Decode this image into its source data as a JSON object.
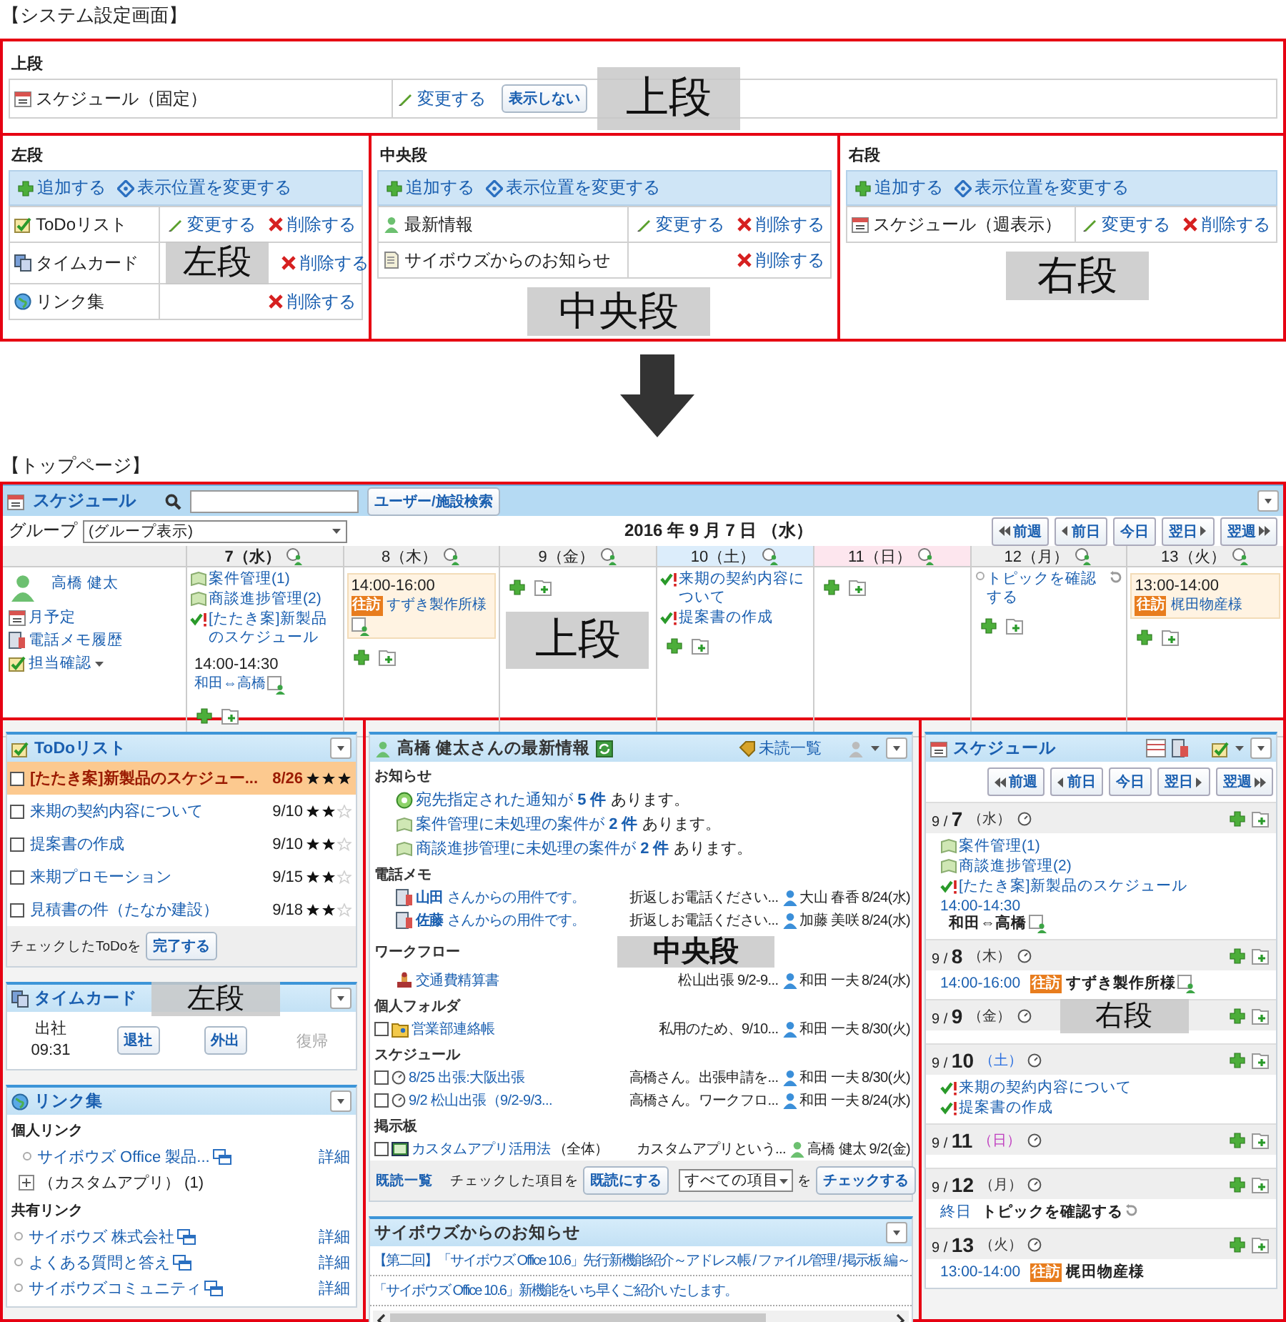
{
  "settings": {
    "title": "【システム設定画面】",
    "upper": {
      "label": "上段",
      "overlay": "上段",
      "rows": [
        {
          "name": "スケジュール（固定）",
          "change": "変更する",
          "hide": "表示しない"
        }
      ]
    },
    "columns": [
      {
        "label": "左段",
        "overlay": "左段",
        "add": "追加する",
        "move": "表示位置を変更する",
        "rows": [
          {
            "name": "ToDoリスト",
            "change": "変更する",
            "delete": "削除する"
          },
          {
            "name": "タイムカード",
            "delete": "削除する"
          },
          {
            "name": "リンク集",
            "delete": "削除する"
          }
        ]
      },
      {
        "label": "中央段",
        "overlay": "中央段",
        "add": "追加する",
        "move": "表示位置を変更する",
        "rows": [
          {
            "name": "最新情報",
            "change": "変更する",
            "delete": "削除する"
          },
          {
            "name": "サイボウズからのお知らせ",
            "delete": "削除する"
          }
        ]
      },
      {
        "label": "右段",
        "overlay": "右段",
        "add": "追加する",
        "move": "表示位置を変更する",
        "rows": [
          {
            "name": "スケジュール（週表示）",
            "change": "変更する",
            "delete": "削除する"
          }
        ]
      }
    ]
  },
  "toppage": {
    "title": "【トップページ】",
    "schedule": {
      "overlay": "上段",
      "title": "スケジュール",
      "search_button": "ユーザー/施設検索",
      "group_label": "グループ",
      "group_value": "(グループ表示)",
      "date": "2016 年 9 月 7 日 （水）",
      "nav": [
        {
          "kind": "prev-week",
          "label": "前週"
        },
        {
          "kind": "prev-day",
          "label": "前日"
        },
        {
          "kind": "today",
          "label": "今日"
        },
        {
          "kind": "next-day",
          "label": "翌日"
        },
        {
          "kind": "next-week",
          "label": "翌週"
        }
      ],
      "user": {
        "name": "高橋 健太",
        "links": [
          "月予定",
          "電話メモ履歴",
          "担当確認"
        ]
      },
      "days": [
        {
          "label": "7（水）",
          "kind": "weekday",
          "today": true,
          "entries": [
            {
              "kind": "app",
              "text": "案件管理(1)"
            },
            {
              "kind": "app",
              "text": "商談進捗管理(2)"
            },
            {
              "kind": "todo",
              "text": "[たたき案]新製品のスケジュール"
            },
            {
              "kind": "event",
              "time": "14:00-14:30",
              "title": "和田⇔高橋",
              "facility": true,
              "highlight": false
            }
          ]
        },
        {
          "label": "8（木）",
          "kind": "weekday",
          "today": false,
          "entries": [
            {
              "kind": "event",
              "time": "14:00-16:00",
              "tag": "往訪",
              "title": "すずき製作所様",
              "facility": true,
              "highlight": true
            }
          ]
        },
        {
          "label": "9（金）",
          "kind": "weekday",
          "today": false
        },
        {
          "label": "10（土）",
          "kind": "saturday",
          "today": false,
          "entries": [
            {
              "kind": "todo",
              "text": "来期の契約内容について"
            },
            {
              "kind": "todo",
              "text": "提案書の作成"
            }
          ]
        },
        {
          "label": "11（日）",
          "kind": "sunday",
          "today": false
        },
        {
          "label": "12（月）",
          "kind": "weekday",
          "today": false,
          "entries": [
            {
              "kind": "allday",
              "title": "トピックを確認する"
            }
          ]
        },
        {
          "label": "13（火）",
          "kind": "weekday",
          "today": false,
          "entries": [
            {
              "kind": "event",
              "time": "13:00-14:00",
              "tag": "往訪",
              "title": "梶田物産様",
              "facility": false,
              "highlight": true
            }
          ]
        }
      ]
    },
    "left": {
      "overlay": "左段",
      "todo": {
        "title": "ToDoリスト",
        "items": [
          {
            "title": "[たたき案]新製品のスケジュー...",
            "date": "8/26",
            "stars": 3,
            "overdue": true,
            "checked": false
          },
          {
            "title": "来期の契約内容について",
            "date": "9/10",
            "stars": 2,
            "overdue": false,
            "checked": false
          },
          {
            "title": "提案書の作成",
            "date": "9/10",
            "stars": 2,
            "overdue": false,
            "checked": false
          },
          {
            "title": "来期プロモーション",
            "date": "9/15",
            "stars": 2,
            "overdue": false,
            "checked": false
          },
          {
            "title": "見積書の件（たなか建設）",
            "date": "9/18",
            "stars": 2,
            "overdue": false,
            "checked": false
          }
        ],
        "footer": "チェックしたToDoを",
        "button": "完了する"
      },
      "timecard": {
        "title": "タイムカード",
        "status": "出社",
        "time": "09:31",
        "buttons": [
          {
            "label": "退社",
            "disabled": false
          },
          {
            "label": "外出",
            "disabled": false
          },
          {
            "label": "復帰",
            "disabled": true
          }
        ]
      },
      "links": {
        "title": "リンク集",
        "groups": [
          {
            "heading": "個人リンク",
            "items": [
              {
                "kind": "link",
                "text": "サイボウズ Office 製品...",
                "detail": "詳細"
              },
              {
                "kind": "folder",
                "text": "（カスタムアプリ） (1)",
                "expanded": false
              }
            ]
          },
          {
            "heading": "共有リンク",
            "items": [
              {
                "kind": "link",
                "text": "サイボウズ 株式会社",
                "detail": "詳細"
              },
              {
                "kind": "link",
                "text": "よくある質問と答え",
                "detail": "詳細"
              },
              {
                "kind": "link",
                "text": "サイボウズコミュニティ",
                "detail": "詳細"
              }
            ]
          }
        ]
      }
    },
    "center": {
      "overlay": "中央段",
      "news": {
        "title": "高橋 健太さんの最新情報",
        "unread": "未読一覧",
        "sections": [
          {
            "heading": "お知らせ",
            "kind": "notice",
            "items": [
              {
                "kind": "notification",
                "text": "宛先指定された通知が",
                "count": "5 件",
                "rest": "あります。"
              },
              {
                "kind": "app",
                "text": "案件管理に未処理の案件が",
                "count": "2 件",
                "rest": "あります。"
              },
              {
                "kind": "app",
                "text": "商談進捗管理に未処理の案件が",
                "count": "2 件",
                "rest": "あります。"
              }
            ]
          },
          {
            "heading": "電話メモ",
            "kind": "memo",
            "items": [
              {
                "title": "**山田** さんからの用件です。",
                "preview": "折返しお電話ください...",
                "person": "大山 春香",
                "color": "#3b8fd9",
                "date": "8/24(水)"
              },
              {
                "title": "**佐藤** さんからの用件です。",
                "preview": "折返しお電話ください...",
                "person": "加藤 美咲",
                "color": "#3b8fd9",
                "date": "8/24(水)"
              }
            ]
          },
          {
            "heading": "ワークフロー",
            "kind": "workflow",
            "items": [
              {
                "title": "交通費精算書",
                "preview": "松山出張 9/2-9...",
                "person": "和田 一夫",
                "color": "#3b8fd9",
                "date": "8/24(水)"
              }
            ]
          },
          {
            "heading": "個人フォルダ",
            "kind": "folder",
            "items": [
              {
                "title": "営業部連絡帳",
                "preview": "私用のため、9/10...",
                "person": "和田 一夫",
                "color": "#3b8fd9",
                "date": "8/30(火)",
                "checked": false
              }
            ]
          },
          {
            "heading": "スケジュール",
            "kind": "schedule",
            "items": [
              {
                "title": "8/25 出張:大阪出張",
                "preview": "高橋さん。出張申請を...",
                "person": "和田 一夫",
                "color": "#3b8fd9",
                "date": "8/30(火)",
                "checked": false
              },
              {
                "title": "9/2 松山出張（9/2-9/3...",
                "preview": "高橋さん。ワークフロ...",
                "person": "和田 一夫",
                "color": "#3b8fd9",
                "date": "8/24(水)",
                "checked": false
              }
            ]
          },
          {
            "heading": "掲示板",
            "kind": "board",
            "items": [
              {
                "title": "カスタムアプリ活用法",
                "note": "（全体）",
                "preview": "カスタムアプリという...",
                "person": "高橋 健太",
                "color": "#6cc070",
                "date": "9/2(金)",
                "checked": false
              }
            ]
          }
        ],
        "footer": {
          "read_list": "既読一覧",
          "label": "チェックした項目を",
          "mark_button": "既読にする",
          "select": "すべての項目",
          "select_suffix": "を",
          "check_button": "チェックする"
        }
      },
      "notices": {
        "title": "サイボウズからのお知らせ",
        "items": [
          "【第二回】「サイボウズ Office 10.6」先行新機能紹介～アドレス帳 / ファイル管理 / 掲示板 編～",
          "「サイボウズ Office 10.6」新機能をいち早くご紹介いたします。"
        ]
      }
    },
    "right": {
      "overlay": "右段",
      "title": "スケジュール",
      "nav": [
        {
          "kind": "prev-week",
          "label": "前週"
        },
        {
          "kind": "prev-day",
          "label": "前日"
        },
        {
          "kind": "today",
          "label": "今日"
        },
        {
          "kind": "next-day",
          "label": "翌日"
        },
        {
          "kind": "next-week",
          "label": "翌週"
        }
      ],
      "days": [
        {
          "date": "9 / **7**",
          "weekday": "（水）",
          "kind": "weekday",
          "entries": [
            {
              "kind": "app",
              "text": "案件管理(1)"
            },
            {
              "kind": "app",
              "text": "商談進捗管理(2)"
            },
            {
              "kind": "todo",
              "text": "[たたき案]新製品のスケジュール"
            },
            {
              "kind": "event",
              "time": "14:00-14:30",
              "title": "和田⇔高橋",
              "facility": true
            }
          ]
        },
        {
          "date": "9 / **8**",
          "weekday": "（木）",
          "kind": "weekday",
          "entries": [
            {
              "kind": "event",
              "time": "14:00-16:00",
              "tag": "往訪",
              "title": "すずき製作所様",
              "facility": true
            }
          ]
        },
        {
          "date": "9 / **9**",
          "weekday": "（金）",
          "kind": "weekday"
        },
        {
          "date": "9 / **10**",
          "weekday": "（土）",
          "kind": "saturday",
          "entries": [
            {
              "kind": "todo",
              "text": "来期の契約内容について"
            },
            {
              "kind": "todo",
              "text": "提案書の作成"
            }
          ]
        },
        {
          "date": "9 / **11**",
          "weekday": "（日）",
          "kind": "sunday"
        },
        {
          "date": "9 / **12**",
          "weekday": "（月）",
          "kind": "weekday",
          "entries": [
            {
              "kind": "allday",
              "time": "終日",
              "title": "トピックを確認する"
            }
          ]
        },
        {
          "date": "9 / **13**",
          "weekday": "（火）",
          "kind": "weekday",
          "entries": [
            {
              "kind": "event",
              "time": "13:00-14:00",
              "tag": "往訪",
              "title": "梶田物産様",
              "facility": false
            }
          ]
        }
      ]
    }
  }
}
